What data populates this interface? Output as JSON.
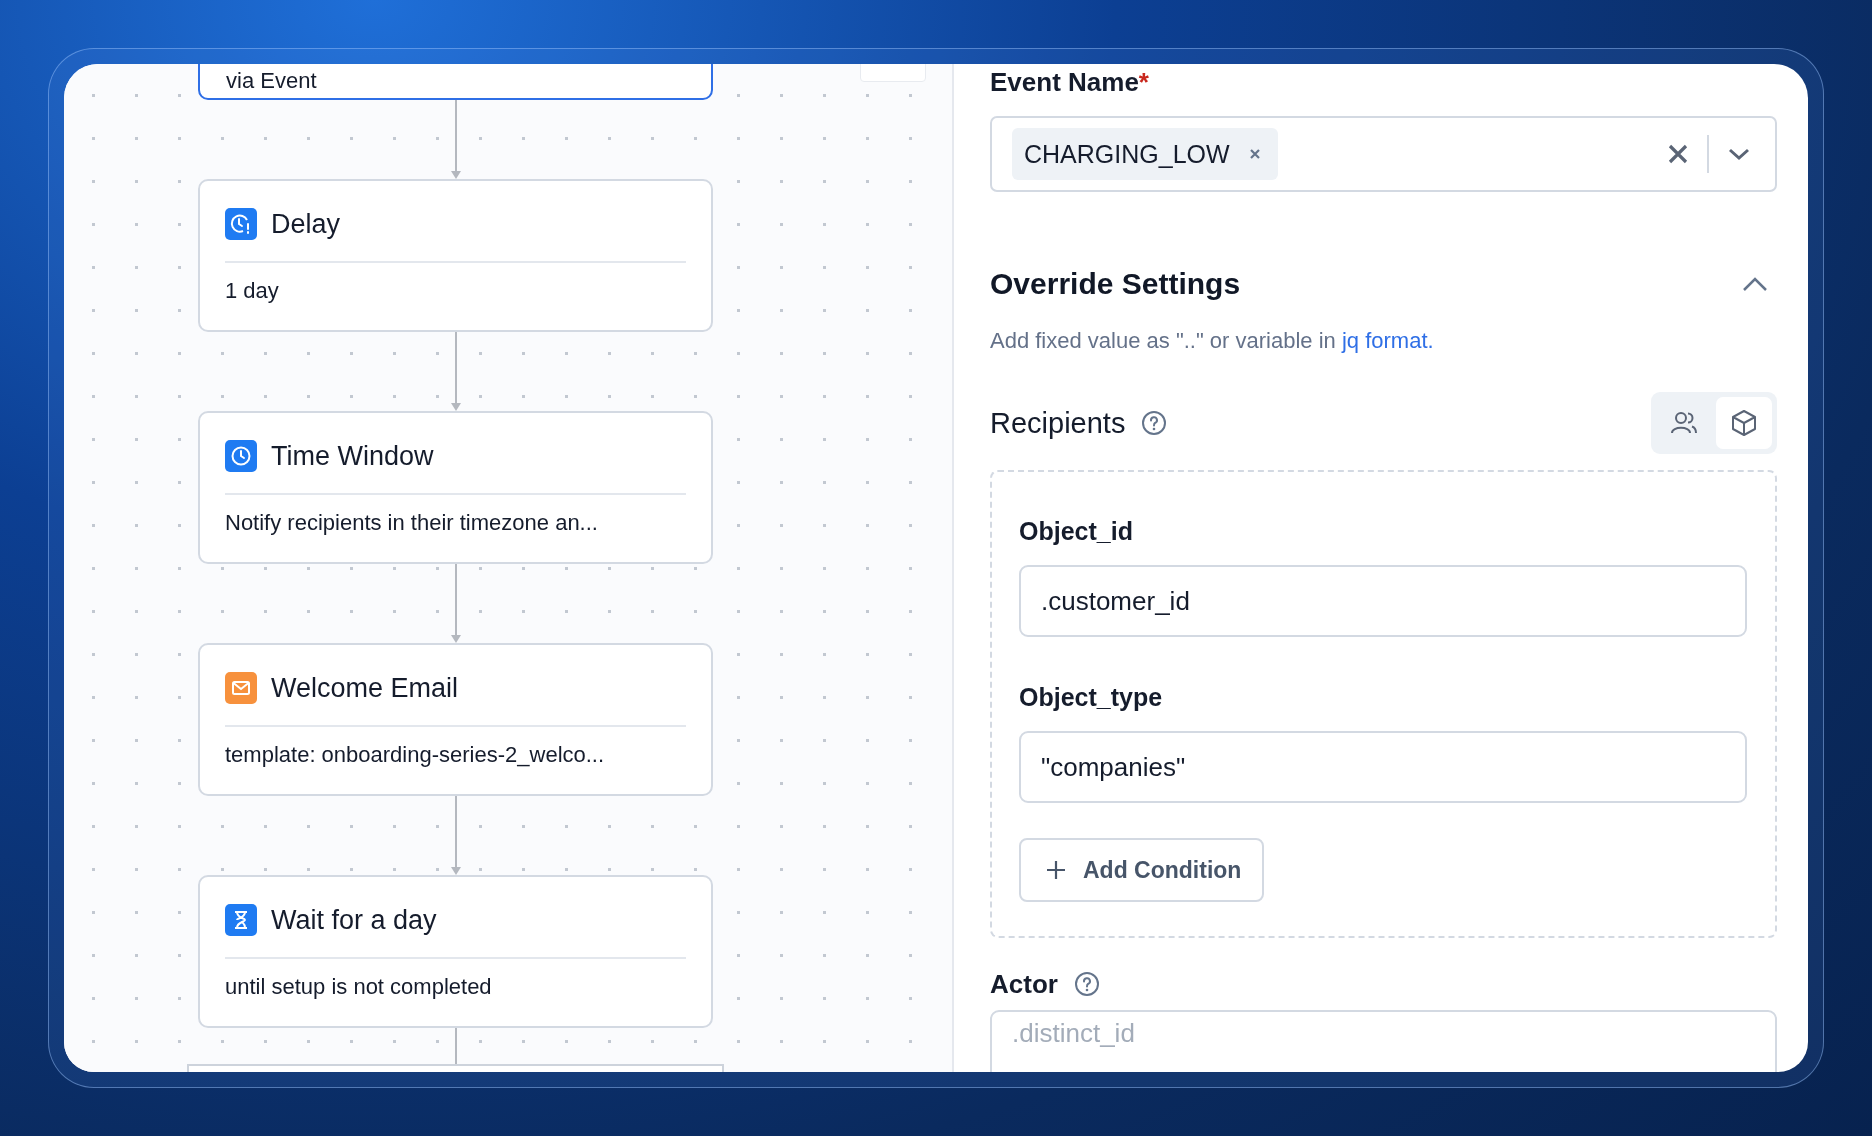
{
  "canvas": {
    "nodes": [
      {
        "kind": "trigger",
        "subtitle": "via Event",
        "selected": true
      },
      {
        "kind": "delay",
        "title": "Delay",
        "subtitle": "1 day",
        "selected": false
      },
      {
        "kind": "time_window",
        "title": "Time Window",
        "subtitle": "Notify recipients in their timezone an...",
        "selected": false
      },
      {
        "kind": "email",
        "title": "Welcome Email",
        "subtitle": "template: onboarding-series-2_welco...",
        "selected": false
      },
      {
        "kind": "wait",
        "title": "Wait for a day",
        "subtitle": "until setup is not completed",
        "selected": false
      }
    ]
  },
  "form": {
    "event_name": {
      "label": "Event Name",
      "required_mark": "*",
      "tags": [
        {
          "label": "CHARGING_LOW"
        }
      ]
    },
    "override": {
      "title": "Override Settings",
      "expanded": true,
      "hint": "Add fixed value as \"..\" or variable in ",
      "hint_link": "jq format."
    },
    "recipients": {
      "label": "Recipients",
      "modes": [
        {
          "kind": "users",
          "selected": false
        },
        {
          "kind": "object",
          "selected": true
        }
      ],
      "fields": [
        {
          "label": "Object_id",
          "value": ".customer_id"
        },
        {
          "label": "Object_type",
          "value": "\"companies\""
        }
      ],
      "add_button": "Add Condition"
    },
    "actor": {
      "label": "Actor",
      "placeholder": ".distinct_id"
    }
  }
}
